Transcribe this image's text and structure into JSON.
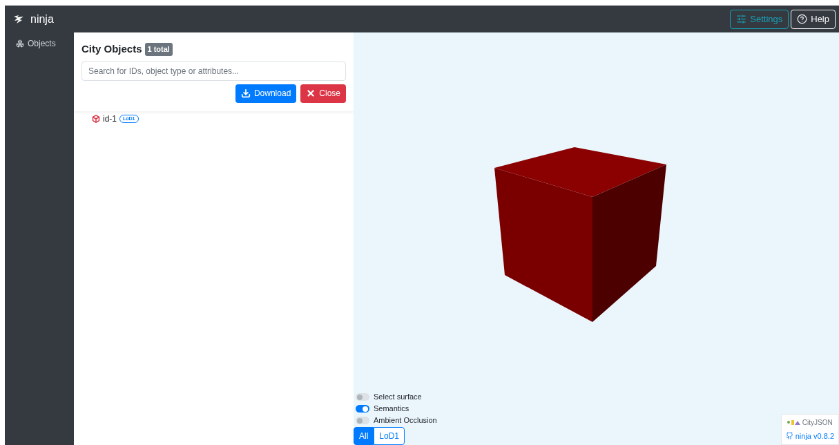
{
  "navbar": {
    "brand": "ninja",
    "buttons": [
      {
        "label": "Settings",
        "kind": "settings"
      },
      {
        "label": "Help",
        "kind": "help"
      }
    ]
  },
  "sidebar": {
    "items": [
      {
        "label": "Objects",
        "selected": true
      }
    ]
  },
  "panel": {
    "title": "City Objects",
    "count": "1 total",
    "search": {
      "placeholder": "Search for IDs, object type or attributes..."
    },
    "buttons": [
      {
        "label": "Download",
        "kind": "download"
      },
      {
        "label": "Close",
        "kind": "close"
      }
    ],
    "objects": [
      {
        "id": "id-1",
        "lod": "LoD1"
      }
    ]
  },
  "viewer": {
    "toggles": [
      {
        "label": "Select surface",
        "on": false
      },
      {
        "label": "Semantics",
        "on": true
      },
      {
        "label": "Ambient Occlusion",
        "on": false
      }
    ],
    "lod_tabs": [
      {
        "label": "All",
        "selected": true
      },
      {
        "label": "LoD1",
        "selected": false
      }
    ],
    "footer": {
      "logo_text": "CityJSON",
      "version": "ninja v0.8.2"
    }
  }
}
